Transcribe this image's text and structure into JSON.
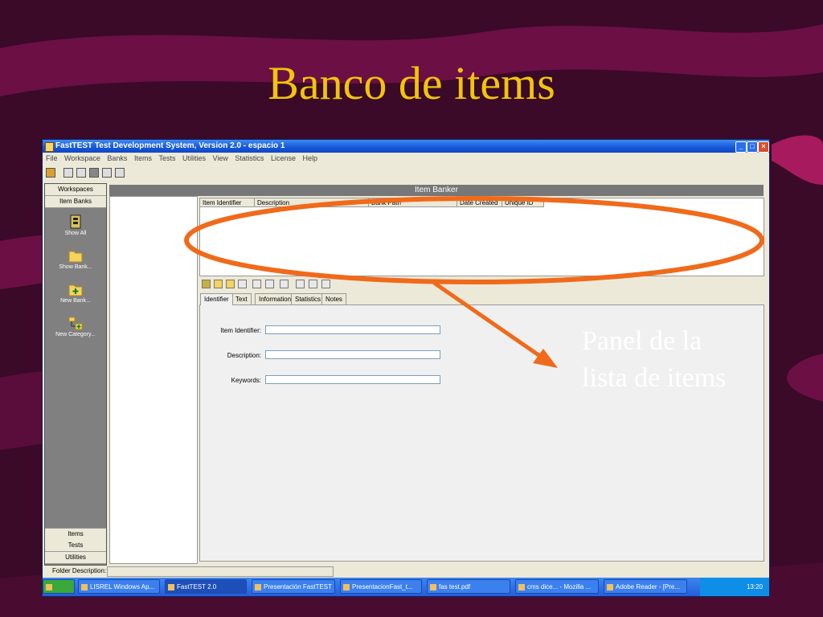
{
  "slide": {
    "title": "Banco de items",
    "callout_line1": "Panel de la",
    "callout_line2": "lista de items",
    "accent_color": "#f2c40a",
    "annotation_color": "#f06a1a"
  },
  "window": {
    "title": "FastTEST Test Development System, Version 2.0 - espacio 1",
    "menu": [
      "File",
      "Workspace",
      "Banks",
      "Items",
      "Tests",
      "Utilities",
      "View",
      "Statistics",
      "License",
      "Help"
    ]
  },
  "leftnav": {
    "workspaces": "Workspaces",
    "item_banks": "Item Banks",
    "icons": [
      {
        "label": "Show All",
        "icon": "bank-icon"
      },
      {
        "label": "Show Bank...",
        "icon": "folder-icon"
      },
      {
        "label": "New Bank...",
        "icon": "new-folder-icon"
      },
      {
        "label": "New Category...",
        "icon": "new-category-icon"
      }
    ],
    "items": "Items",
    "tests": "Tests",
    "utilities": "Utilities"
  },
  "banker": {
    "header": "Item Banker",
    "columns": [
      "Item Identifier",
      "Description",
      "Bank Path",
      "Date Created",
      "Unique ID"
    ]
  },
  "tabs": [
    "Identifier",
    "Text",
    "Information",
    "Statistics",
    "Notes"
  ],
  "form": {
    "item_identifier_label": "Item Identifier:",
    "description_label": "Description:",
    "keywords_label": "Keywords:"
  },
  "status": {
    "folder_description": "Folder Description:"
  },
  "taskbar": {
    "tasks": [
      "LISREL Windows Ap...",
      "FastTEST 2.0",
      "Presentación FastTEST",
      "PresentacionFast_t...",
      "fas test.pdf",
      "cms dice... - Mozilla ...",
      "Adobe Reader - [Pre..."
    ],
    "clock": "13:20"
  }
}
